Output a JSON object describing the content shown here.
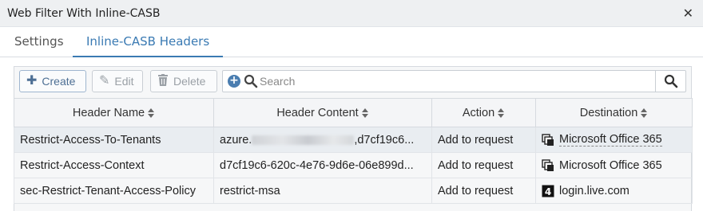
{
  "window": {
    "title": "Web Filter With Inline-CASB"
  },
  "tabs": [
    {
      "label": "Settings",
      "active": false
    },
    {
      "label": "Inline-CASB Headers",
      "active": true
    }
  ],
  "toolbar": {
    "create_label": "Create",
    "edit_label": "Edit",
    "delete_label": "Delete",
    "search_placeholder": "Search"
  },
  "table": {
    "columns": [
      "Header Name",
      "Header Content",
      "Action",
      "Destination"
    ],
    "rows": [
      {
        "name": "Restrict-Access-To-Tenants",
        "content_prefix": "azure.",
        "content_suffix": ",d7cf19c6...",
        "action": "Add to request",
        "destination": "Microsoft Office 365",
        "dest_icon": "app-group-icon",
        "selected": true
      },
      {
        "name": "Restrict-Access-Context",
        "content": "d7cf19c6-620c-4e76-9d6e-06e899d...",
        "action": "Add to request",
        "destination": "Microsoft Office 365",
        "dest_icon": "app-group-icon",
        "selected": false
      },
      {
        "name": "sec-Restrict-Tenant-Access-Policy",
        "content": "restrict-msa",
        "action": "Add to request",
        "destination": "login.live.com",
        "dest_icon": "fqdn-icon",
        "selected": false
      }
    ]
  },
  "colors": {
    "accent": "#3a7ab3",
    "header_bg": "#eef0f2",
    "selected_row": "#e9edf1"
  }
}
